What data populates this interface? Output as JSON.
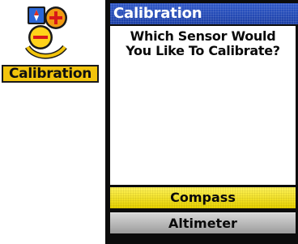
{
  "app": {
    "icon_name": "calibration-app-icon",
    "label": "Calibration",
    "label_bg": "#f2c40c"
  },
  "dialog": {
    "title": "Calibration",
    "title_bg": "#1b3fa6",
    "question_line1": "Which Sensor Would",
    "question_line2": "You Like To Calibrate?"
  },
  "options": [
    {
      "label": "Compass",
      "selected": true,
      "color": "#f2e416"
    },
    {
      "label": "Altimeter",
      "selected": false,
      "color": "#b8b8b8"
    }
  ]
}
